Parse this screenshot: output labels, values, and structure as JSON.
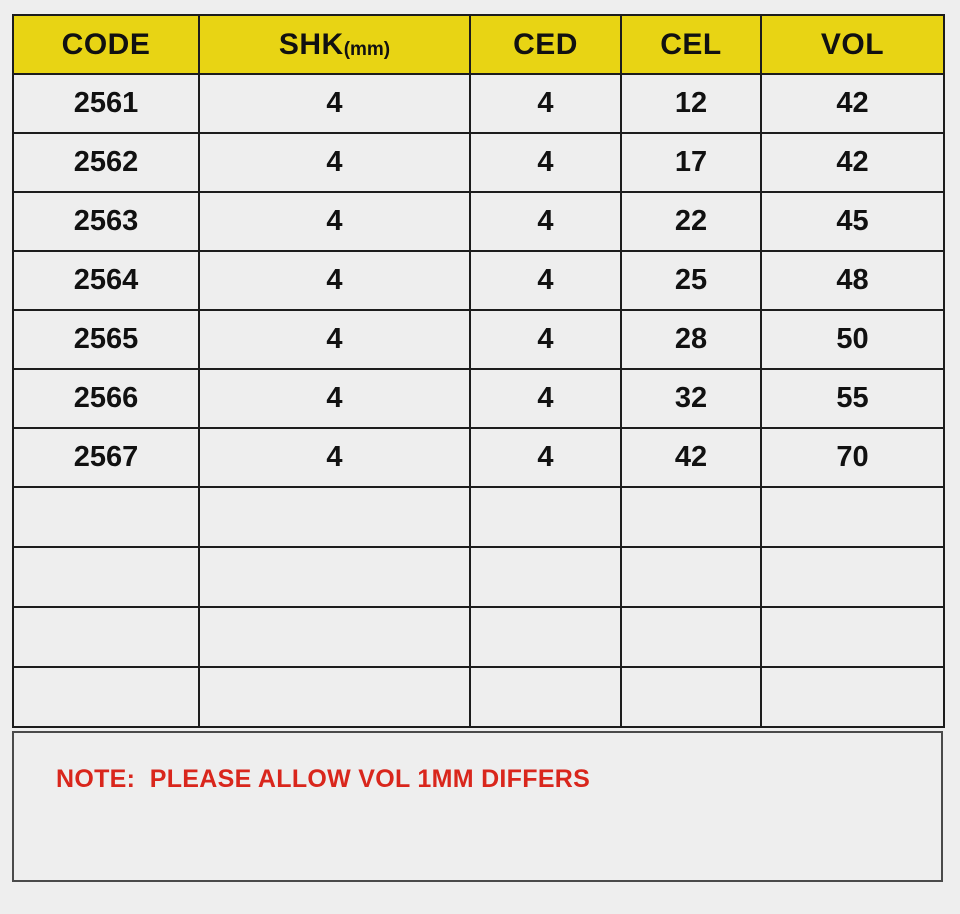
{
  "table": {
    "columns": [
      {
        "key": "code",
        "label": "CODE",
        "unit": ""
      },
      {
        "key": "shk",
        "label": "SHK",
        "unit": "(mm)"
      },
      {
        "key": "ced",
        "label": "CED",
        "unit": ""
      },
      {
        "key": "cel",
        "label": "CEL",
        "unit": ""
      },
      {
        "key": "vol",
        "label": "VOL",
        "unit": ""
      }
    ],
    "header_background": "#e8d414",
    "header_text_color": "#111111",
    "border_color": "#1c1c1c",
    "row_background": "#eeeeee",
    "rows": [
      {
        "code": "2561",
        "shk": "4",
        "ced": "4",
        "cel": "12",
        "vol": "42"
      },
      {
        "code": "2562",
        "shk": "4",
        "ced": "4",
        "cel": "17",
        "vol": "42"
      },
      {
        "code": "2563",
        "shk": "4",
        "ced": "4",
        "cel": "22",
        "vol": "45"
      },
      {
        "code": "2564",
        "shk": "4",
        "ced": "4",
        "cel": "25",
        "vol": "48"
      },
      {
        "code": "2565",
        "shk": "4",
        "ced": "4",
        "cel": "28",
        "vol": "50"
      },
      {
        "code": "2566",
        "shk": "4",
        "ced": "4",
        "cel": "32",
        "vol": "55"
      },
      {
        "code": "2567",
        "shk": "4",
        "ced": "4",
        "cel": "42",
        "vol": "70"
      }
    ],
    "empty_rows": [
      {
        "code": "",
        "shk": "",
        "ced": "",
        "cel": "",
        "vol": ""
      },
      {
        "code": "",
        "shk": "",
        "ced": "",
        "cel": "",
        "vol": ""
      },
      {
        "code": "",
        "shk": "",
        "ced": "",
        "cel": "",
        "vol": ""
      },
      {
        "code": "",
        "shk": "",
        "ced": "",
        "cel": "",
        "vol": ""
      }
    ]
  },
  "note": {
    "text": "NOTE:  PLEASE ALLOW VOL 1MM DIFFERS",
    "color": "#d9261c",
    "border_color": "#4a4a4a"
  },
  "page": {
    "background": "#eeeeee"
  }
}
